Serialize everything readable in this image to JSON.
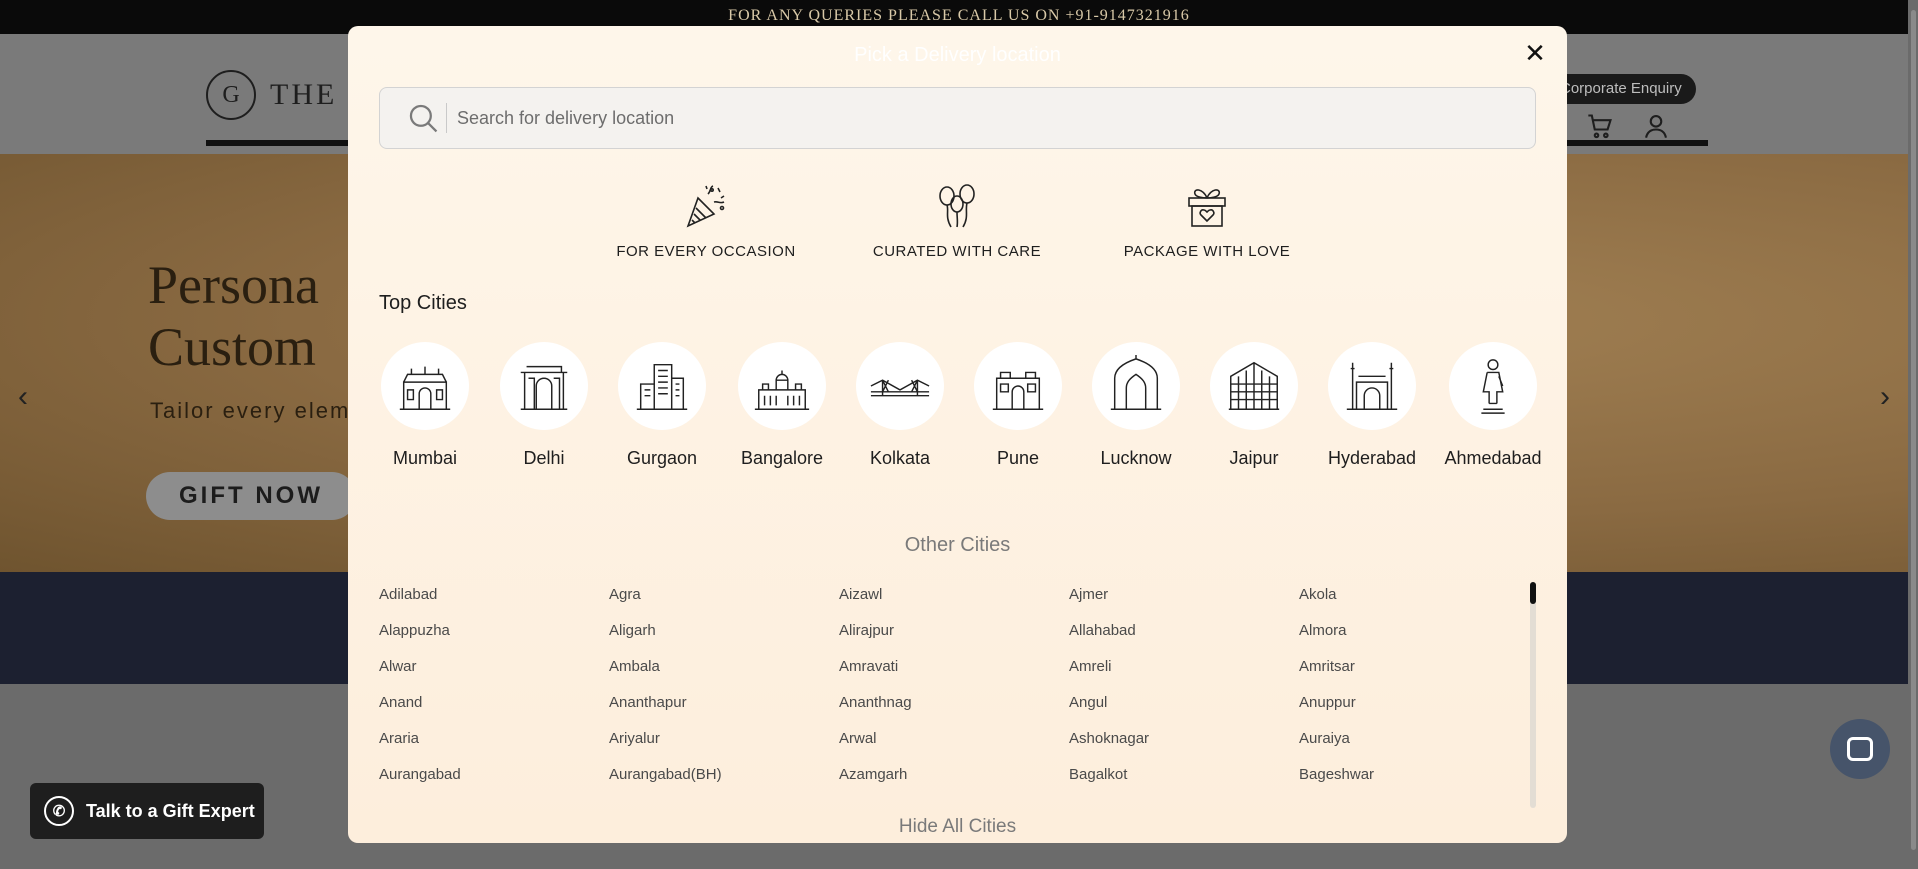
{
  "page": {
    "announcement": "FOR ANY QUERIES PLEASE CALL US ON +91-9147321916",
    "logo_mark": "G",
    "logo_text": "THE G",
    "corporate_enquiry": "Corporate Enquiry",
    "hero": {
      "title_line1": "Persona",
      "title_line2": "Custom",
      "subtitle": "Tailor every elem",
      "cta": "GIFT NOW"
    },
    "talk_to_expert": "Talk to a Gift Expert"
  },
  "modal": {
    "title": "Pick a Delivery location",
    "close_label": "✕",
    "search": {
      "placeholder": "Search for delivery location",
      "value": ""
    },
    "features": [
      {
        "label": "FOR EVERY OCCASION",
        "icon": "party-popper-icon"
      },
      {
        "label": "CURATED WITH CARE",
        "icon": "balloons-icon"
      },
      {
        "label": "PACKAGE WITH LOVE",
        "icon": "gift-box-icon"
      }
    ],
    "top_cities_title": "Top Cities",
    "top_cities": [
      {
        "name": "Mumbai",
        "icon": "gateway-of-india-icon"
      },
      {
        "name": "Delhi",
        "icon": "india-gate-icon"
      },
      {
        "name": "Gurgaon",
        "icon": "skyscraper-icon"
      },
      {
        "name": "Bangalore",
        "icon": "vidhana-soudha-icon"
      },
      {
        "name": "Kolkata",
        "icon": "howrah-bridge-icon"
      },
      {
        "name": "Pune",
        "icon": "shaniwar-wada-icon"
      },
      {
        "name": "Lucknow",
        "icon": "rumi-darwaza-icon"
      },
      {
        "name": "Jaipur",
        "icon": "hawa-mahal-icon"
      },
      {
        "name": "Hyderabad",
        "icon": "charminar-icon"
      },
      {
        "name": "Ahmedabad",
        "icon": "statue-icon"
      }
    ],
    "other_cities_title": "Other Cities",
    "other_cities": [
      "Adilabad",
      "Agra",
      "Aizawl",
      "Ajmer",
      "Akola",
      "Alappuzha",
      "Aligarh",
      "Alirajpur",
      "Allahabad",
      "Almora",
      "Alwar",
      "Ambala",
      "Amravati",
      "Amreli",
      "Amritsar",
      "Anand",
      "Ananthapur",
      "Ananthnag",
      "Angul",
      "Anuppur",
      "Araria",
      "Ariyalur",
      "Arwal",
      "Ashoknagar",
      "Auraiya",
      "Aurangabad",
      "Aurangabad(BH)",
      "Azamgarh",
      "Bagalkot",
      "Bageshwar"
    ],
    "hide_all_cities": "Hide All Cities"
  }
}
